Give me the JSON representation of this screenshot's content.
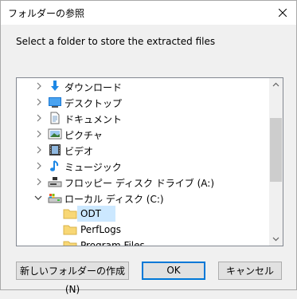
{
  "dialog": {
    "title": "フォルダーの参照",
    "instruction": "Select a folder to store the extracted files"
  },
  "tree": {
    "items": [
      {
        "label": "ダウンロード",
        "icon": "download-icon",
        "expanded": false
      },
      {
        "label": "デスクトップ",
        "icon": "desktop-icon",
        "expanded": false
      },
      {
        "label": "ドキュメント",
        "icon": "documents-icon",
        "expanded": false
      },
      {
        "label": "ピクチャ",
        "icon": "pictures-icon",
        "expanded": false
      },
      {
        "label": "ビデオ",
        "icon": "videos-icon",
        "expanded": false
      },
      {
        "label": "ミュージック",
        "icon": "music-icon",
        "expanded": false
      },
      {
        "label": "フロッピー ディスク ドライブ (A:)",
        "icon": "floppy-drive-icon",
        "expanded": false
      },
      {
        "label": "ローカル ディスク (C:)",
        "icon": "local-disk-icon",
        "expanded": true
      },
      {
        "label": "ODT",
        "icon": "folder-icon",
        "selected": true
      },
      {
        "label": "PerfLogs",
        "icon": "folder-icon"
      },
      {
        "label": "Program Files",
        "icon": "folder-icon"
      }
    ]
  },
  "buttons": {
    "new_folder": "新しいフォルダーの作成(N)",
    "ok": "OK",
    "cancel": "キャンセル"
  },
  "colors": {
    "selection": "#cce8ff",
    "default_button_border": "#0078d7",
    "folder": "#f8d775"
  }
}
